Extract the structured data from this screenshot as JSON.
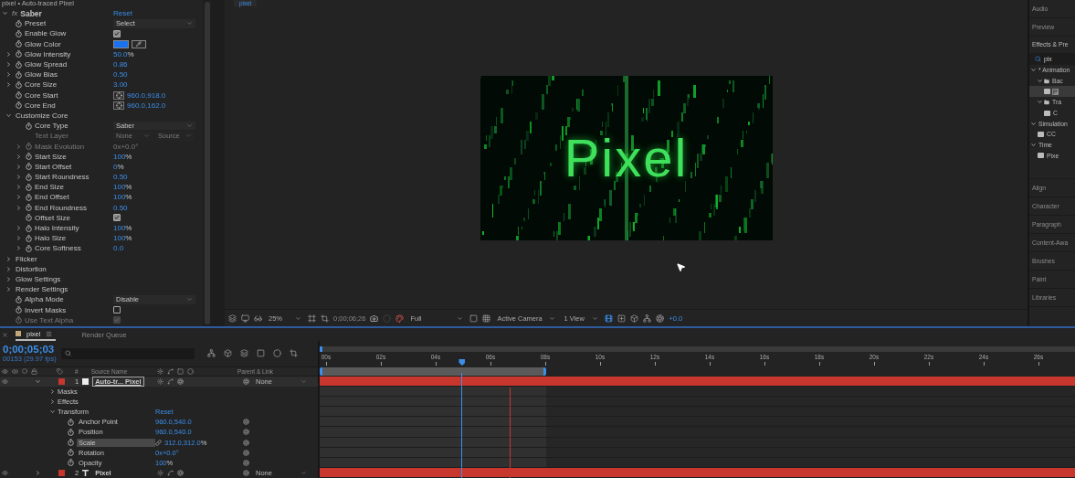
{
  "effect_controls": {
    "header": "pixel • Auto-traced Pixel",
    "effect": {
      "badge": "fx",
      "name": "Saber",
      "reset": "Reset",
      "expanded": true,
      "properties": [
        {
          "kind": "dropdown",
          "label": "Preset",
          "value": "Select",
          "disabled": false
        },
        {
          "kind": "checkbox",
          "label": "Enable Glow",
          "checked": true,
          "disabled": false
        },
        {
          "kind": "color",
          "label": "Glow Color",
          "color": "#1a72f0",
          "disabled": false
        },
        {
          "kind": "number",
          "label": "Glow Intensity",
          "value": "50.0",
          "unit": "%",
          "expanded": false,
          "disabled": false
        },
        {
          "kind": "number",
          "label": "Glow Spread",
          "value": "0.86",
          "expanded": false,
          "disabled": false
        },
        {
          "kind": "number",
          "label": "Glow Bias",
          "value": "0.50",
          "expanded": false,
          "disabled": false
        },
        {
          "kind": "number",
          "label": "Core Size",
          "value": "3.00",
          "expanded": false,
          "disabled": false
        },
        {
          "kind": "point",
          "label": "Core Start",
          "value": "960.0,918.0",
          "disabled": false
        },
        {
          "kind": "point",
          "label": "Core End",
          "value": "960.0,162.0",
          "disabled": false
        },
        {
          "kind": "group",
          "label": "Customize Core",
          "expanded": true,
          "children": [
            {
              "kind": "dropdown",
              "label": "Core Type",
              "value": "Saber",
              "disabled": false
            },
            {
              "kind": "dropdown-pair",
              "label": "Text Layer",
              "values": [
                "None",
                "Source"
              ],
              "disabled": true
            },
            {
              "kind": "number",
              "label": "Mask Evolution",
              "value": "0x+0.0°",
              "expanded": false,
              "disabled": true
            },
            {
              "kind": "number",
              "label": "Start Size",
              "value": "100",
              "unit": "%",
              "expanded": false,
              "disabled": false
            },
            {
              "kind": "number",
              "label": "Start Offset",
              "value": "0",
              "unit": "%",
              "expanded": false,
              "disabled": false
            },
            {
              "kind": "number",
              "label": "Start Roundness",
              "value": "0.50",
              "expanded": false,
              "disabled": false
            },
            {
              "kind": "number",
              "label": "End Size",
              "value": "100",
              "unit": "%",
              "expanded": false,
              "disabled": false
            },
            {
              "kind": "number",
              "label": "End Offset",
              "value": "100",
              "unit": "%",
              "expanded": false,
              "disabled": false
            },
            {
              "kind": "number",
              "label": "End Roundness",
              "value": "0.50",
              "expanded": false,
              "disabled": false
            },
            {
              "kind": "checkbox",
              "label": "Offset Size",
              "checked": true,
              "disabled": false
            },
            {
              "kind": "number",
              "label": "Halo Intensity",
              "value": "100",
              "unit": "%",
              "expanded": false,
              "disabled": false
            },
            {
              "kind": "number",
              "label": "Halo Size",
              "value": "100",
              "unit": "%",
              "expanded": false,
              "disabled": false
            },
            {
              "kind": "number",
              "label": "Core Softness",
              "value": "0.0",
              "expanded": false,
              "disabled": false
            }
          ]
        },
        {
          "kind": "group",
          "label": "Flicker",
          "expanded": false
        },
        {
          "kind": "group",
          "label": "Distortion",
          "expanded": false
        },
        {
          "kind": "group",
          "label": "Glow Settings",
          "expanded": false
        },
        {
          "kind": "group",
          "label": "Render Settings",
          "expanded": false
        },
        {
          "kind": "dropdown",
          "label": "Alpha Mode",
          "value": "Disable",
          "disabled": false
        },
        {
          "kind": "checkbox",
          "label": "Invert Masks",
          "checked": false,
          "disabled": false
        },
        {
          "kind": "checkbox",
          "label": "Use Text Alpha",
          "checked": true,
          "disabled": true
        }
      ]
    }
  },
  "viewer": {
    "tab": "pixel",
    "frame_text": "Pixel",
    "toolbar": {
      "zoom": "25%",
      "timecode": "0;00;06;26",
      "resolution": "Full",
      "camera": "Active Camera",
      "views": "1 View",
      "exposure": "+0.0"
    }
  },
  "right_panel": {
    "panels_top": [
      "Audio",
      "Preview"
    ],
    "effects_presets": {
      "title": "Effects & Pre",
      "search": "pix",
      "tree": [
        {
          "label": "* Animation",
          "expanded": true,
          "selected": false,
          "children": [
            {
              "label": "Bac",
              "kind": "folder",
              "expanded": true,
              "selected": false,
              "children": [
                {
                  "label": "P",
                  "kind": "preset",
                  "selected": true
                }
              ]
            },
            {
              "label": "Tra",
              "kind": "folder",
              "expanded": true,
              "selected": false,
              "children": [
                {
                  "label": "C",
                  "kind": "preset",
                  "selected": false
                }
              ]
            }
          ]
        },
        {
          "label": "Simulation",
          "expanded": true,
          "selected": false,
          "children": [
            {
              "label": "CC",
              "kind": "preset",
              "selected": false
            }
          ]
        },
        {
          "label": "Time",
          "expanded": true,
          "selected": false,
          "children": [
            {
              "label": "Pixe",
              "kind": "preset",
              "selected": false
            }
          ]
        }
      ]
    },
    "panels_bottom": [
      "Align",
      "Character",
      "Paragraph",
      "Content-Awa",
      "Brushes",
      "Paint",
      "Libraries"
    ]
  },
  "timeline": {
    "tabs": [
      {
        "label": "pixel",
        "selected": true
      },
      {
        "label": "Render Queue",
        "selected": false
      }
    ],
    "current_time": "0;00;05;03",
    "frame_info": "00153 (29.97 fps)",
    "columns": {
      "number": "#",
      "source_name": "Source Name",
      "parent": "Parent & Link"
    },
    "layers": [
      {
        "number": "1",
        "name": "Auto-tr... Pixel",
        "kind": "shape",
        "color": "#c8372d",
        "parent": "None",
        "expanded": true,
        "selected": true,
        "groups": [
          {
            "label": "Masks",
            "expanded": false
          },
          {
            "label": "Effects",
            "expanded": false
          },
          {
            "label": "Transform",
            "expanded": true,
            "reset": "Reset",
            "properties": [
              {
                "label": "Anchor Point",
                "value": "960.0,540.0",
                "selected": false
              },
              {
                "label": "Position",
                "value": "960.0,540.0",
                "selected": false
              },
              {
                "label": "Scale",
                "value": "312.0,312.0",
                "unit": "%",
                "linked": true,
                "selected": true
              },
              {
                "label": "Rotation",
                "value": "0x+0.0°",
                "selected": false
              },
              {
                "label": "Opacity",
                "value": "100",
                "unit": "%",
                "selected": false
              }
            ]
          }
        ]
      },
      {
        "number": "2",
        "name": "Pixel",
        "kind": "text",
        "color": "#c8372d",
        "parent": "None",
        "expanded": false,
        "selected": false
      }
    ],
    "ruler": [
      "00s",
      "02s",
      "04s",
      "06s",
      "08s",
      "10s",
      "12s",
      "14s",
      "16s",
      "18s",
      "20s",
      "22s",
      "24s",
      "26s"
    ],
    "playhead": {
      "level": 0.188
    },
    "work_area": {
      "level": 0.3
    },
    "marker": {
      "level": 0.251
    }
  }
}
